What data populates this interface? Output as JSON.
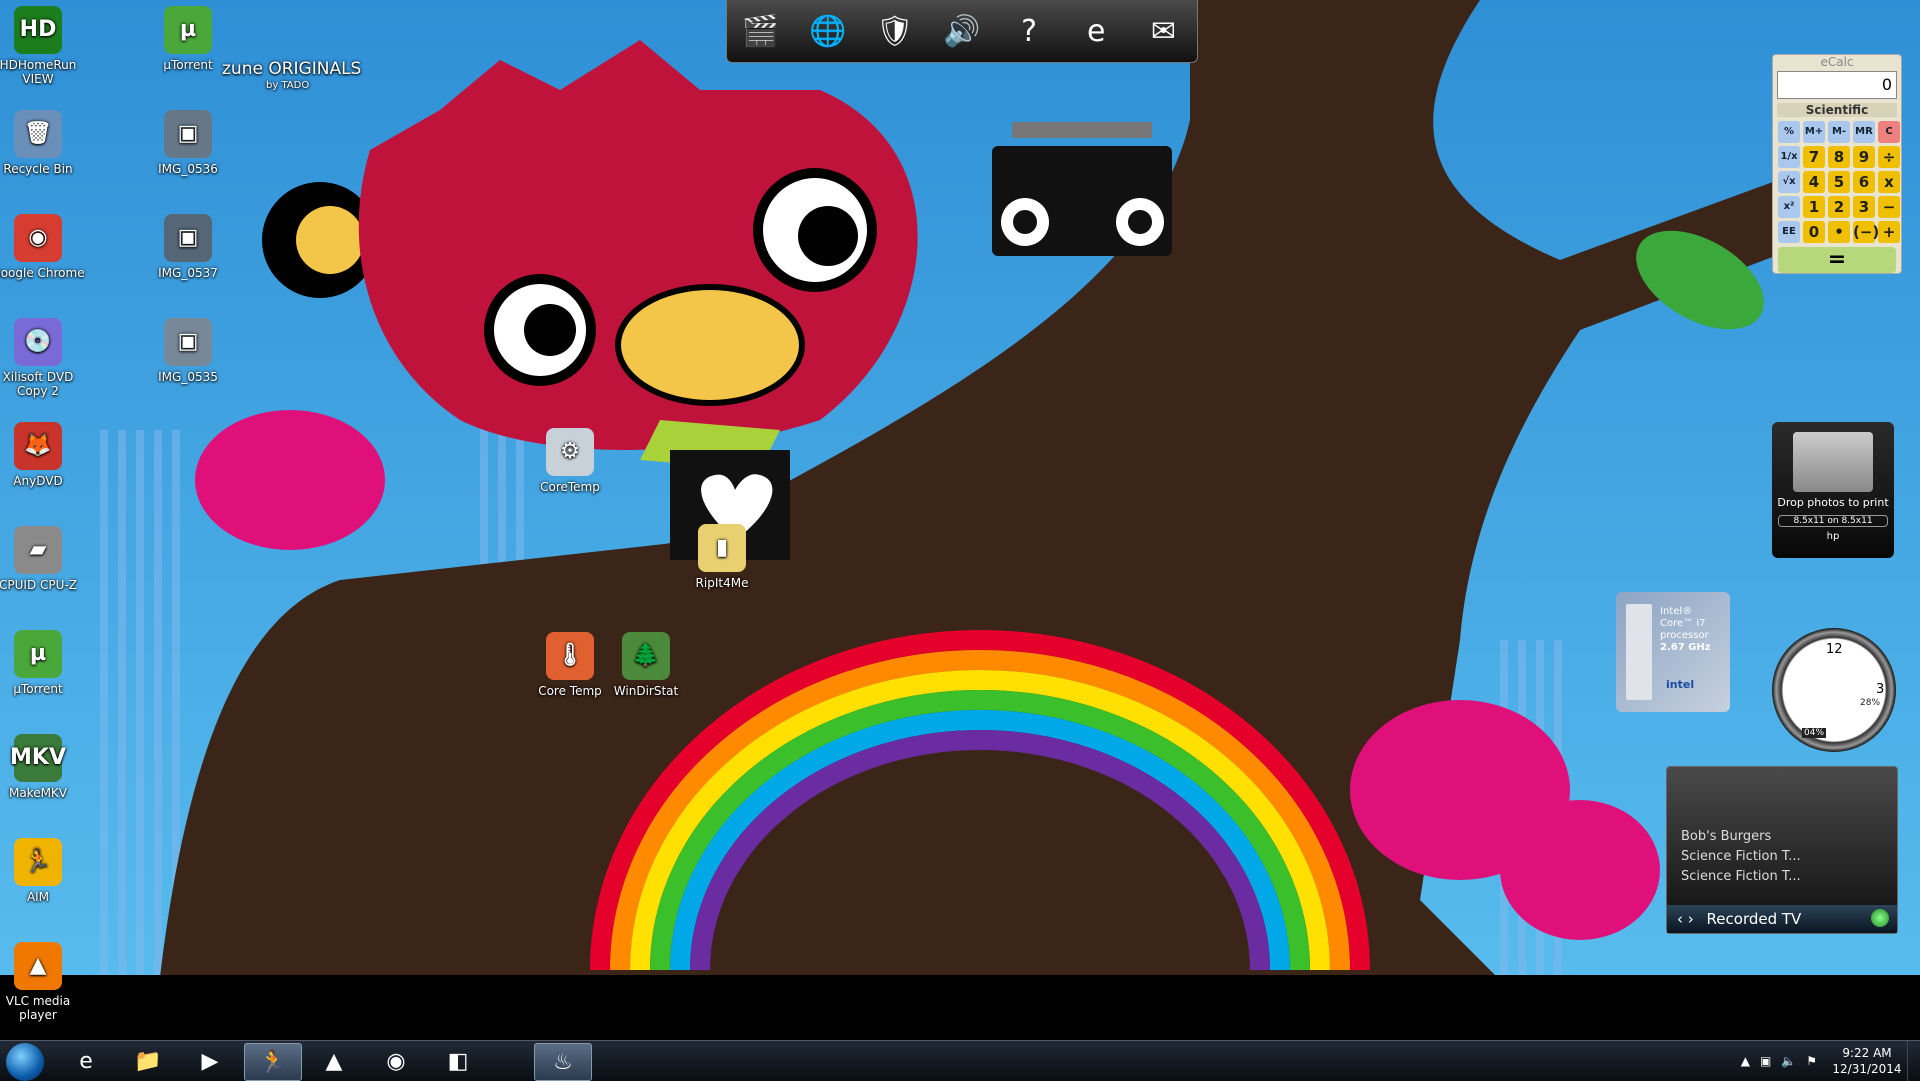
{
  "desktop_icons_col1": [
    {
      "label": "HDHomeRun VIEW",
      "glyph": "HD",
      "color": "#1b7d1b"
    },
    {
      "label": "Recycle Bin",
      "glyph": "🗑",
      "color": "#6a8fb8"
    },
    {
      "label": "Google Chrome",
      "glyph": "◉",
      "color": "#d63c2f"
    },
    {
      "label": "Xilisoft DVD Copy 2",
      "glyph": "💿",
      "color": "#7a6ad8"
    },
    {
      "label": "AnyDVD",
      "glyph": "🦊",
      "color": "#c8342a"
    },
    {
      "label": "CPUID CPU-Z",
      "glyph": "▰",
      "color": "#8a8a8a"
    },
    {
      "label": "µTorrent",
      "glyph": "µ",
      "color": "#4aa73a"
    },
    {
      "label": "MakeMKV",
      "glyph": "MKV",
      "color": "#3a7a3a"
    },
    {
      "label": "AIM",
      "glyph": "🏃",
      "color": "#f0b400"
    },
    {
      "label": "VLC media player",
      "glyph": "▲",
      "color": "#f07800"
    }
  ],
  "desktop_icons_col2": [
    {
      "label": "µTorrent",
      "glyph": "µ",
      "color": "#4aa73a"
    },
    {
      "label": "IMG_0536",
      "glyph": "▣",
      "color": "#667788"
    },
    {
      "label": "IMG_0537",
      "glyph": "▣",
      "color": "#556677"
    },
    {
      "label": "IMG_0535",
      "glyph": "▣",
      "color": "#778899"
    }
  ],
  "desktop_icons_center": [
    {
      "label": "CoreTemp",
      "glyph": "⚙",
      "color": "#c8d0d8"
    },
    {
      "label": "RipIt4Me",
      "glyph": "▮",
      "color": "#e8d070"
    },
    {
      "label": "Core Temp",
      "glyph": "🌡",
      "color": "#e06030"
    },
    {
      "label": "WinDirStat",
      "glyph": "🌲",
      "color": "#4a8a3a"
    }
  ],
  "wallpaper_brand": "zune ORIGINALS",
  "wallpaper_brand_sub": "by TADO",
  "dock": [
    "🎬",
    "🌐",
    "🛡",
    "🔊",
    "?",
    "e",
    "✉"
  ],
  "calc": {
    "title": "eCalc",
    "display": "0",
    "mode": "Scientific",
    "keys": [
      "%",
      "M+",
      "M-",
      "MR",
      "C",
      "1/x",
      "7",
      "8",
      "9",
      "÷",
      "√x",
      "4",
      "5",
      "6",
      "x",
      "x²",
      "1",
      "2",
      "3",
      "−",
      "EE",
      "0",
      "•",
      "(−)",
      "+"
    ],
    "equals": "="
  },
  "printer": {
    "label": "Drop photos to print",
    "size": "8.5x11 on 8.5x11",
    "brand": "hp"
  },
  "cpu_gadget": {
    "line1": "Intel®",
    "line2": "Core™ i7",
    "line3": "processor",
    "line4": "2.67 GHz",
    "brand": "intel"
  },
  "clock_gadget": {
    "num12": "12",
    "num3": "3",
    "cpu_pct": "04%",
    "mem_pct": "28%"
  },
  "recorded_tv": {
    "items": [
      "Bob's Burgers",
      "Science Fiction T...",
      "Science Fiction T..."
    ],
    "footer": "Recorded TV"
  },
  "taskbar": {
    "pinned": [
      "e",
      "📁",
      "▶",
      "🏃",
      "▲",
      "◉",
      "◧",
      "♨"
    ],
    "time": "9:22 AM",
    "date": "12/31/2014"
  }
}
